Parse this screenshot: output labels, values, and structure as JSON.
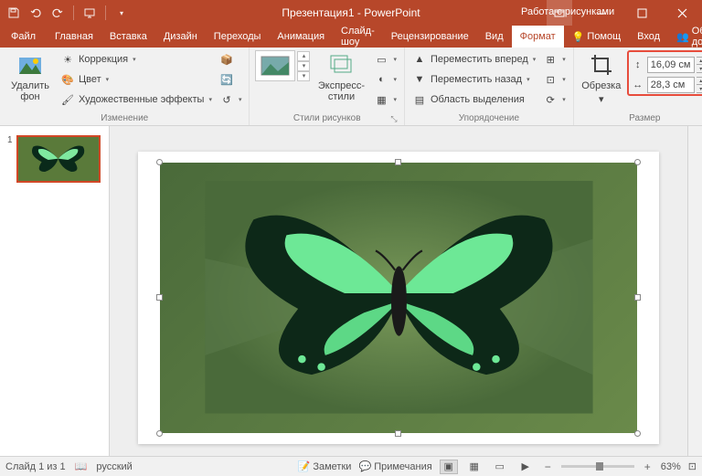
{
  "title": "Презентация1 - PowerPoint",
  "contextual_title": "Работа с рисунками",
  "tabs": {
    "file": "Файл",
    "home": "Главная",
    "insert": "Вставка",
    "design": "Дизайн",
    "transitions": "Переходы",
    "animations": "Анимация",
    "slideshow": "Слайд-шоу",
    "review": "Рецензирование",
    "view": "Вид",
    "format": "Формат",
    "help": "Помощ",
    "login": "Вход",
    "share": "Общий доступ"
  },
  "ribbon": {
    "remove_bg": "Удалить фон",
    "corrections": "Коррекция",
    "color": "Цвет",
    "artistic": "Художественные эффекты",
    "group_change": "Изменение",
    "express_styles": "Экспресс-стили",
    "group_styles": "Стили рисунков",
    "bring_forward": "Переместить вперед",
    "send_backward": "Переместить назад",
    "selection_pane": "Область выделения",
    "group_arrange": "Упорядочение",
    "crop": "Обрезка",
    "height": "16,09 см",
    "width": "28,3 см",
    "group_size": "Размер"
  },
  "status": {
    "slide": "Слайд 1 из 1",
    "lang": "русский",
    "notes": "Заметки",
    "comments": "Примечания",
    "zoom": "63%"
  }
}
